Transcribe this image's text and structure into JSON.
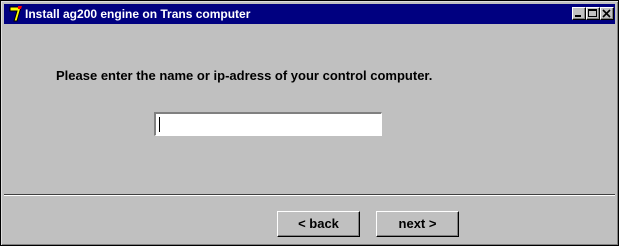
{
  "window": {
    "title": "Install ag200 engine on Trans computer",
    "controls": [
      "minimize-icon",
      "maximize-icon",
      "close-icon"
    ]
  },
  "main": {
    "prompt": "Please enter the name or ip-adress of your control computer.",
    "host_input": {
      "value": "",
      "placeholder": ""
    }
  },
  "footer": {
    "back_label": "< back",
    "next_label": "next >"
  },
  "colors": {
    "titlebar": "#000080",
    "face": "#c0c0c0",
    "text": "#000000"
  }
}
